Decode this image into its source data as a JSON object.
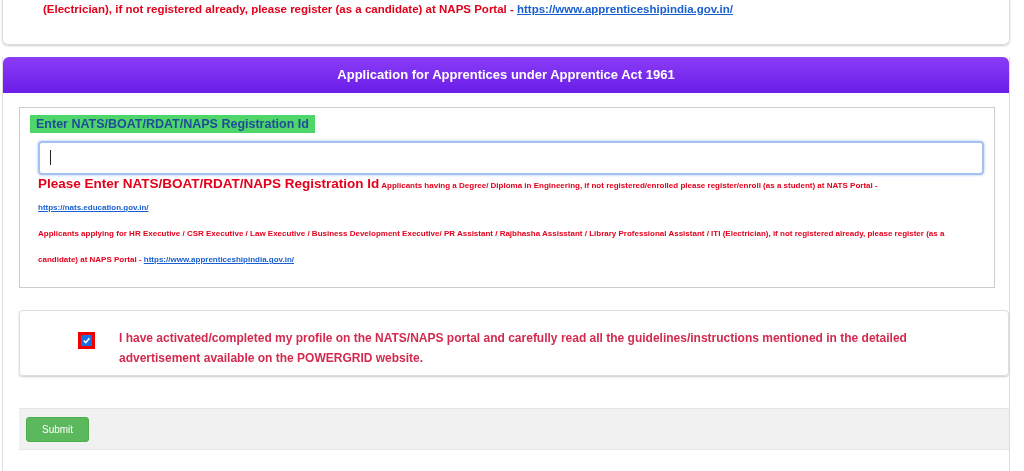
{
  "top_notice": {
    "text": "(Electrician), if not registered already, please register (as a candidate) at NAPS Portal -",
    "link": "https://www.apprenticeshipindia.gov.in/"
  },
  "panel": {
    "title": "Application for Apprentices under Apprentice Act 1961",
    "field": {
      "label": "Enter NATS/BOAT/RDAT/NAPS Registration Id",
      "focused": true
    },
    "error": "Please Enter NATS/BOAT/RDAT/NAPS Registration Id",
    "notes": [
      {
        "text": "Applicants having a Degree/ Diploma in Engineering, if not registered/enrolled please register/enroll (as a student) at NATS Portal -",
        "link": "https://nats.education.gov.in/"
      },
      {
        "text": "Applicants applying for HR Executive / CSR Executive / Law Executive / Business Development Executive/ PR Assistant / Rajbhasha Assisstant / Library Professional Assistant / ITI (Electrician), if not registered already, please register (as a candidate) at NAPS Portal -",
        "link": "https://www.apprenticeshipindia.gov.in/"
      }
    ],
    "consent": {
      "text": "I have activated/completed my profile on the NATS/NAPS portal and carefully read all the guidelines/instructions mentioned in the detailed advertisement available on the POWERGRID website.",
      "checked": true
    },
    "submit": "Submit"
  }
}
